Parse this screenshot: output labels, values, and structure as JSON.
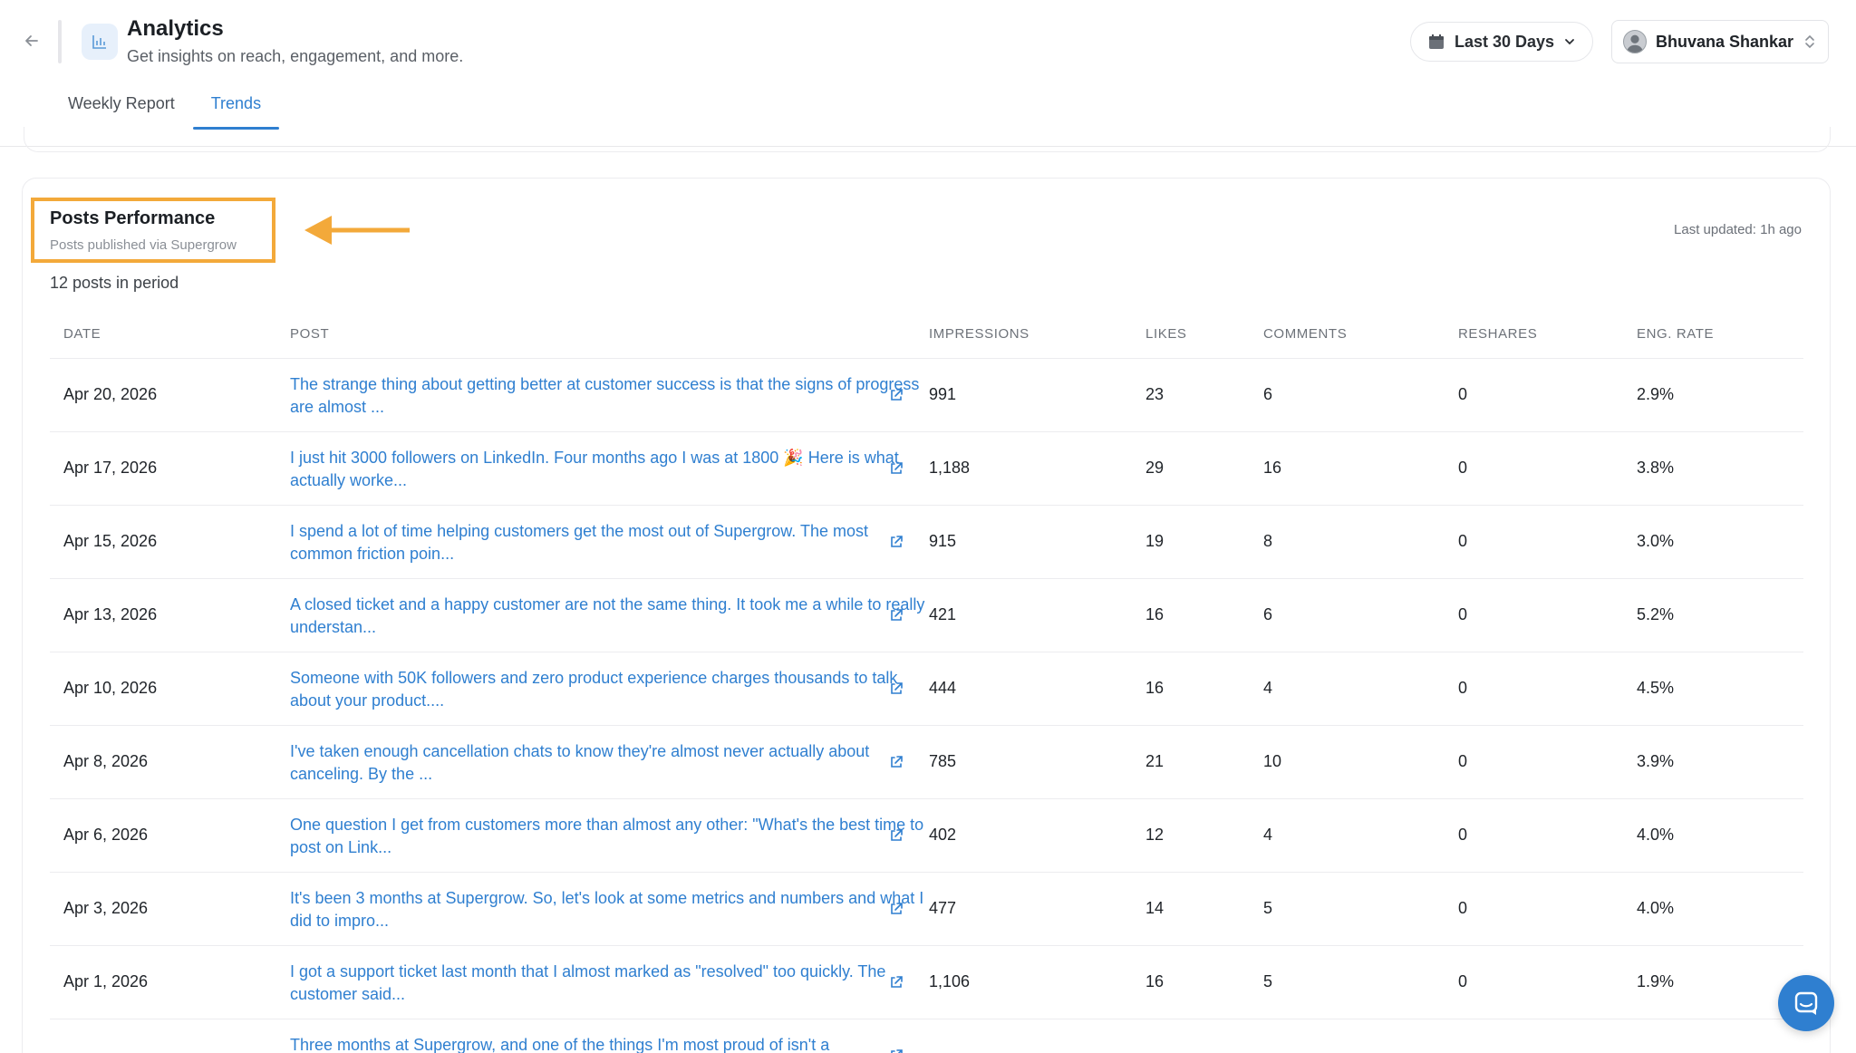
{
  "header": {
    "title": "Analytics",
    "subtitle": "Get insights on reach, engagement, and more.",
    "date_range": "Last 30 Days",
    "user_name": "Bhuvana Shankar"
  },
  "tabs": [
    {
      "label": "Weekly Report",
      "active": false
    },
    {
      "label": "Trends",
      "active": true
    }
  ],
  "section": {
    "title": "Posts Performance",
    "subtitle": "Posts published via Supergrow",
    "last_updated": "Last updated: 1h ago",
    "count_text": "12 posts in period"
  },
  "table": {
    "columns": [
      "DATE",
      "POST",
      "IMPRESSIONS",
      "LIKES",
      "COMMENTS",
      "RESHARES",
      "ENG. RATE"
    ],
    "rows": [
      {
        "date": "Apr 20, 2026",
        "post": "The strange thing about getting better at customer success is that the signs of progress are almost ...",
        "impressions": "991",
        "likes": "23",
        "comments": "6",
        "reshares": "0",
        "eng_rate": "2.9%"
      },
      {
        "date": "Apr 17, 2026",
        "post": "I just hit 3000 followers on LinkedIn. Four months ago I was at 1800 🎉 Here is what actually worke...",
        "impressions": "1,188",
        "likes": "29",
        "comments": "16",
        "reshares": "0",
        "eng_rate": "3.8%"
      },
      {
        "date": "Apr 15, 2026",
        "post": "I spend a lot of time helping customers get the most out of Supergrow. The most common friction poin...",
        "impressions": "915",
        "likes": "19",
        "comments": "8",
        "reshares": "0",
        "eng_rate": "3.0%"
      },
      {
        "date": "Apr 13, 2026",
        "post": "A closed ticket and a happy customer are not the same thing. It took me a while to really understan...",
        "impressions": "421",
        "likes": "16",
        "comments": "6",
        "reshares": "0",
        "eng_rate": "5.2%"
      },
      {
        "date": "Apr 10, 2026",
        "post": "Someone with 50K followers and zero product experience charges thousands to talk about your product....",
        "impressions": "444",
        "likes": "16",
        "comments": "4",
        "reshares": "0",
        "eng_rate": "4.5%"
      },
      {
        "date": "Apr 8, 2026",
        "post": "I've taken enough cancellation chats to know they're almost never actually about canceling. By the ...",
        "impressions": "785",
        "likes": "21",
        "comments": "10",
        "reshares": "0",
        "eng_rate": "3.9%"
      },
      {
        "date": "Apr 6, 2026",
        "post": "One question I get from customers more than almost any other: \"What's the best time to post on Link...",
        "impressions": "402",
        "likes": "12",
        "comments": "4",
        "reshares": "0",
        "eng_rate": "4.0%"
      },
      {
        "date": "Apr 3, 2026",
        "post": "It's been 3 months at Supergrow. So, let's look at some metrics and numbers and what I did to impro...",
        "impressions": "477",
        "likes": "14",
        "comments": "5",
        "reshares": "0",
        "eng_rate": "4.0%"
      },
      {
        "date": "Apr 1, 2026",
        "post": "I got a support ticket last month that I almost marked as \"resolved\" too quickly. The customer said...",
        "impressions": "1,106",
        "likes": "16",
        "comments": "5",
        "reshares": "0",
        "eng_rate": "1.9%"
      },
      {
        "date": "",
        "post": "Three months at Supergrow, and one of the things I'm most proud of isn't a",
        "impressions": "",
        "likes": "",
        "comments": "",
        "reshares": "",
        "eng_rate": ""
      }
    ]
  },
  "colors": {
    "accent": "#2f7fd0",
    "highlight": "#f3a93a",
    "border": "#ececef"
  },
  "icons": {
    "back": "arrow-left-icon",
    "app": "bar-chart-icon",
    "calendar": "calendar-icon",
    "chevron": "chevron-down-icon",
    "sort": "chevron-updown-icon",
    "external": "external-link-icon",
    "chat": "chat-icon"
  }
}
